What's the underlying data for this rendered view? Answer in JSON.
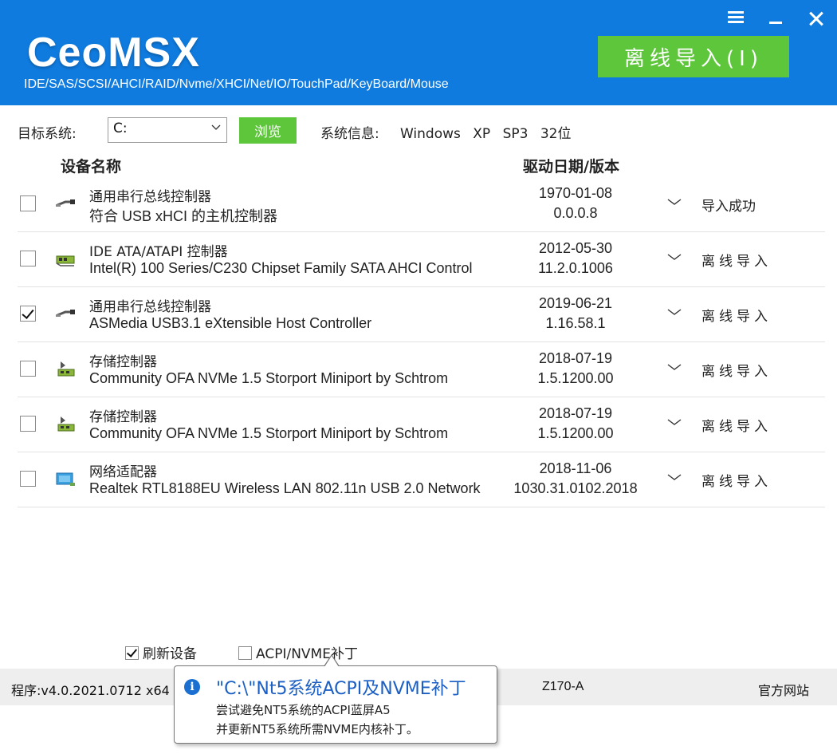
{
  "app": {
    "logo": "CeoMSX",
    "subtitle": "IDE/SAS/SCSI/AHCI/RAID/Nvme/XHCI/Net/IO/TouchPad/KeyBoard/Mouse",
    "import_button": "离线导入(I)"
  },
  "target": {
    "label": "目标系统:",
    "value": "C:",
    "browse": "浏览",
    "sysinfo_label": "系统信息:",
    "sysinfo_value": "Windows XP SP3 32位"
  },
  "columns": {
    "name": "设备名称",
    "date": "驱动日期/版本"
  },
  "devices": [
    {
      "category": "通用串行总线控制器",
      "name": "符合 USB xHCI 的主机控制器",
      "date": "1970-01-08",
      "version": "0.0.0.8",
      "action": "导入成功",
      "checked": false,
      "icon": "usb-icon"
    },
    {
      "category": "IDE ATA/ATAPI 控制器",
      "name": "Intel(R) 100 Series/C230 Chipset Family SATA AHCI Control",
      "date": "2012-05-30",
      "version": "11.2.0.1006",
      "action": "离线导入",
      "checked": false,
      "icon": "ide-controller-icon"
    },
    {
      "category": "通用串行总线控制器",
      "name": "ASMedia USB3.1 eXtensible Host Controller",
      "date": "2019-06-21",
      "version": "1.16.58.1",
      "action": "离线导入",
      "checked": true,
      "icon": "usb-icon"
    },
    {
      "category": "存储控制器",
      "name": "Community OFA NVMe 1.5 Storport Miniport by Schtrom",
      "date": "2018-07-19",
      "version": "1.5.1200.00",
      "action": "离线导入",
      "checked": false,
      "icon": "storage-controller-icon"
    },
    {
      "category": "存储控制器",
      "name": "Community OFA NVMe 1.5 Storport Miniport by Schtrom",
      "date": "2018-07-19",
      "version": "1.5.1200.00",
      "action": "离线导入",
      "checked": false,
      "icon": "storage-controller-icon"
    },
    {
      "category": "网络适配器",
      "name": "Realtek RTL8188EU Wireless LAN 802.11n USB 2.0 Network",
      "date": "2018-11-06",
      "version": "1030.31.0102.2018",
      "action": "离线导入",
      "checked": false,
      "icon": "network-adapter-icon"
    }
  ],
  "options": {
    "refresh": {
      "label": "刷新设备",
      "checked": true
    },
    "acpi": {
      "label": "ACPI/NVME补丁",
      "checked": false
    }
  },
  "status": {
    "version": "程序:v4.0.2021.0712 x64",
    "board": "Z170-A",
    "website": "官方网站"
  },
  "tooltip": {
    "title": "\"C:\\\"Nt5系统ACPI及NVME补丁",
    "line1": "尝试避免NT5系统的ACPI蓝屏A5",
    "line2": "并更新NT5系统所需NVME内核补丁。"
  },
  "colors": {
    "header": "#0f7bdf",
    "accent_green": "#5ec63b",
    "tooltip_title": "#1b5fc4"
  }
}
